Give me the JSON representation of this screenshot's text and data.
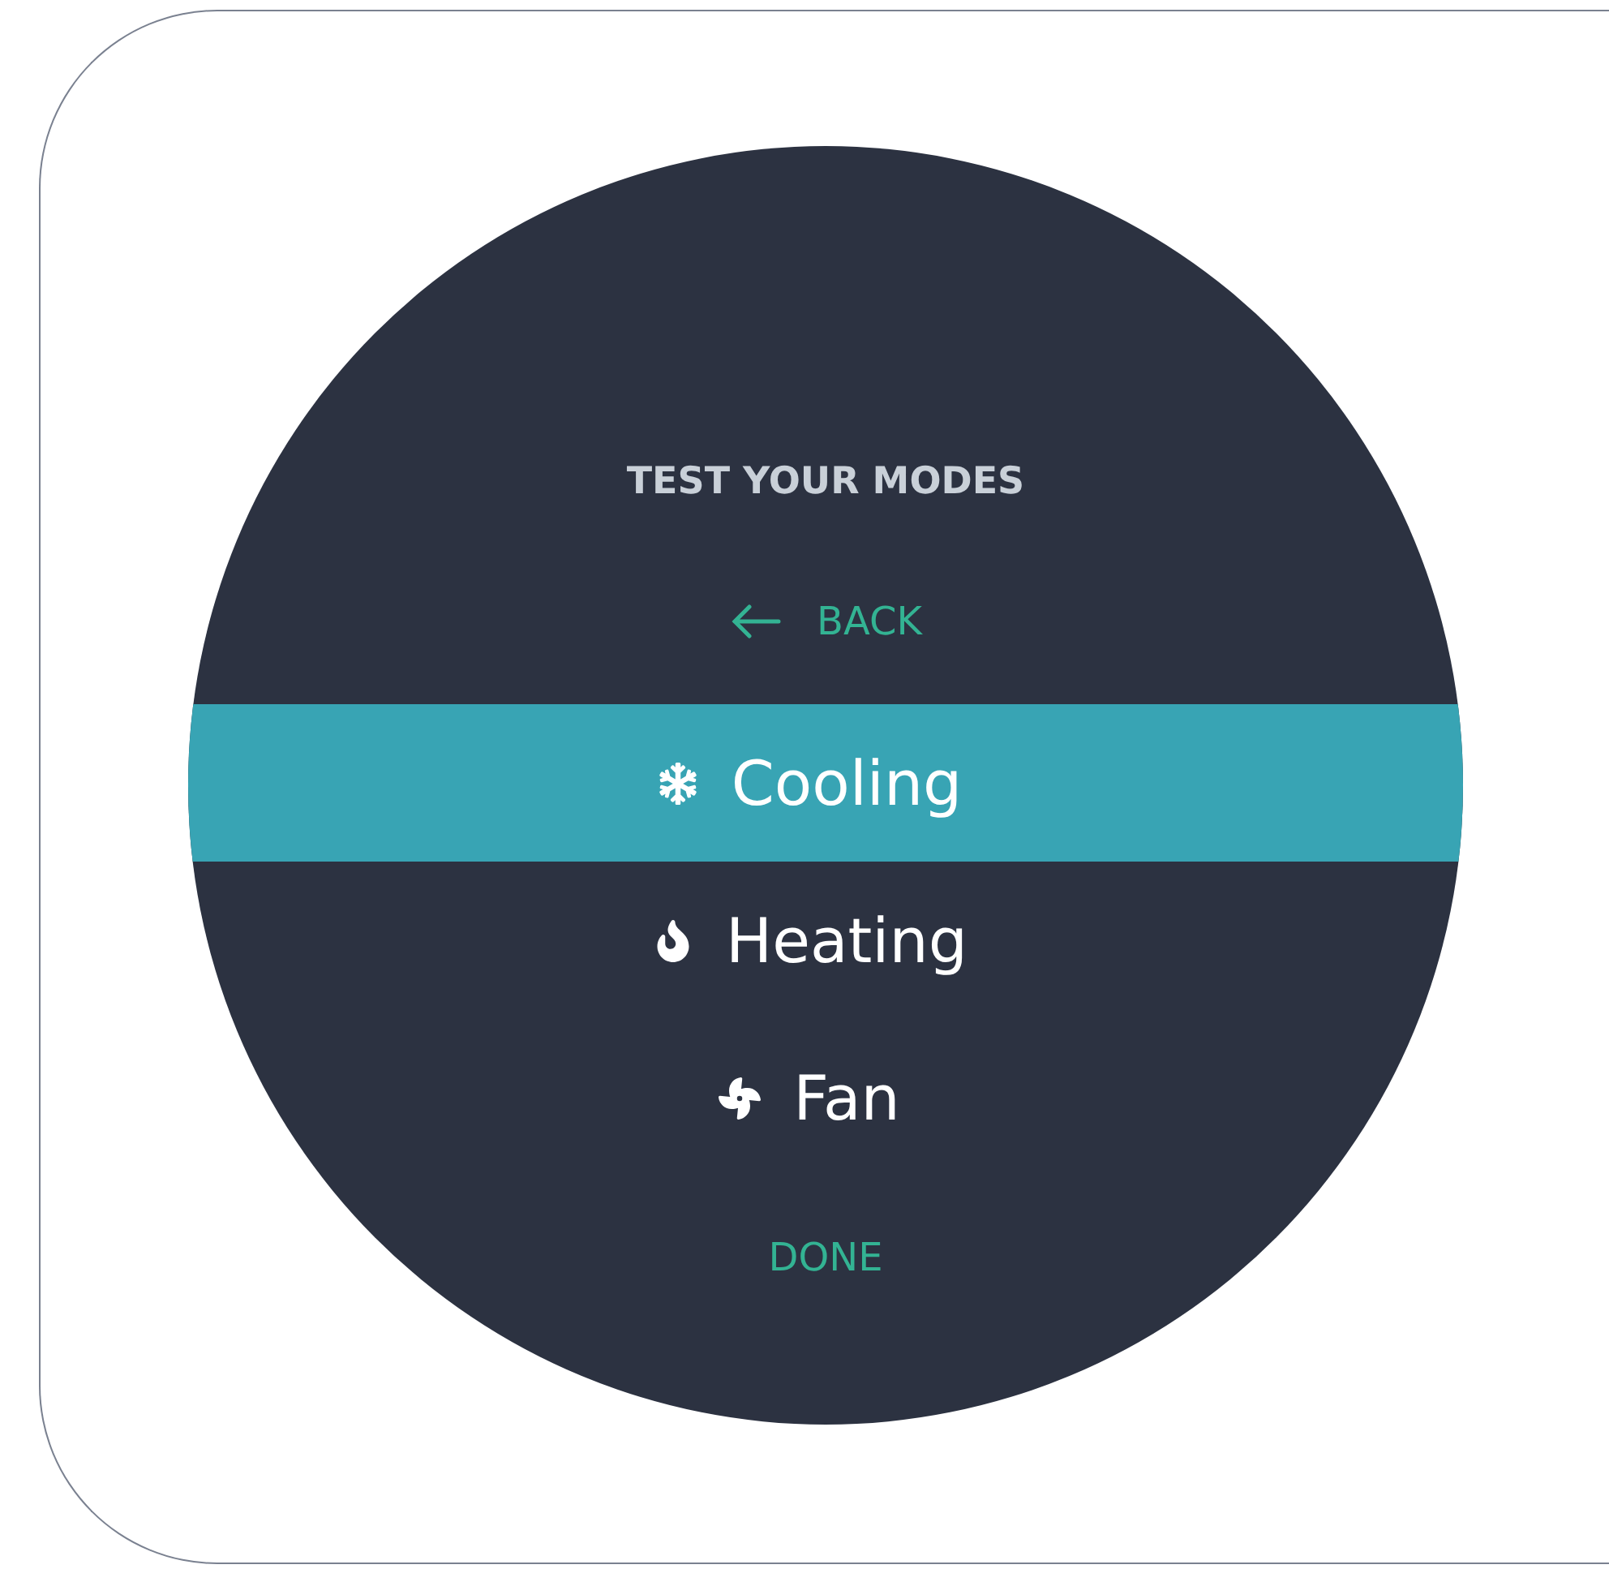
{
  "title": "TEST YOUR MODES",
  "back": {
    "label": "BACK"
  },
  "modes": [
    {
      "kind": "cooling",
      "label": "Cooling",
      "selected": true
    },
    {
      "kind": "heating",
      "label": "Heating",
      "selected": false
    },
    {
      "kind": "fan",
      "label": "Fan",
      "selected": false
    }
  ],
  "done": {
    "label": "DONE"
  }
}
